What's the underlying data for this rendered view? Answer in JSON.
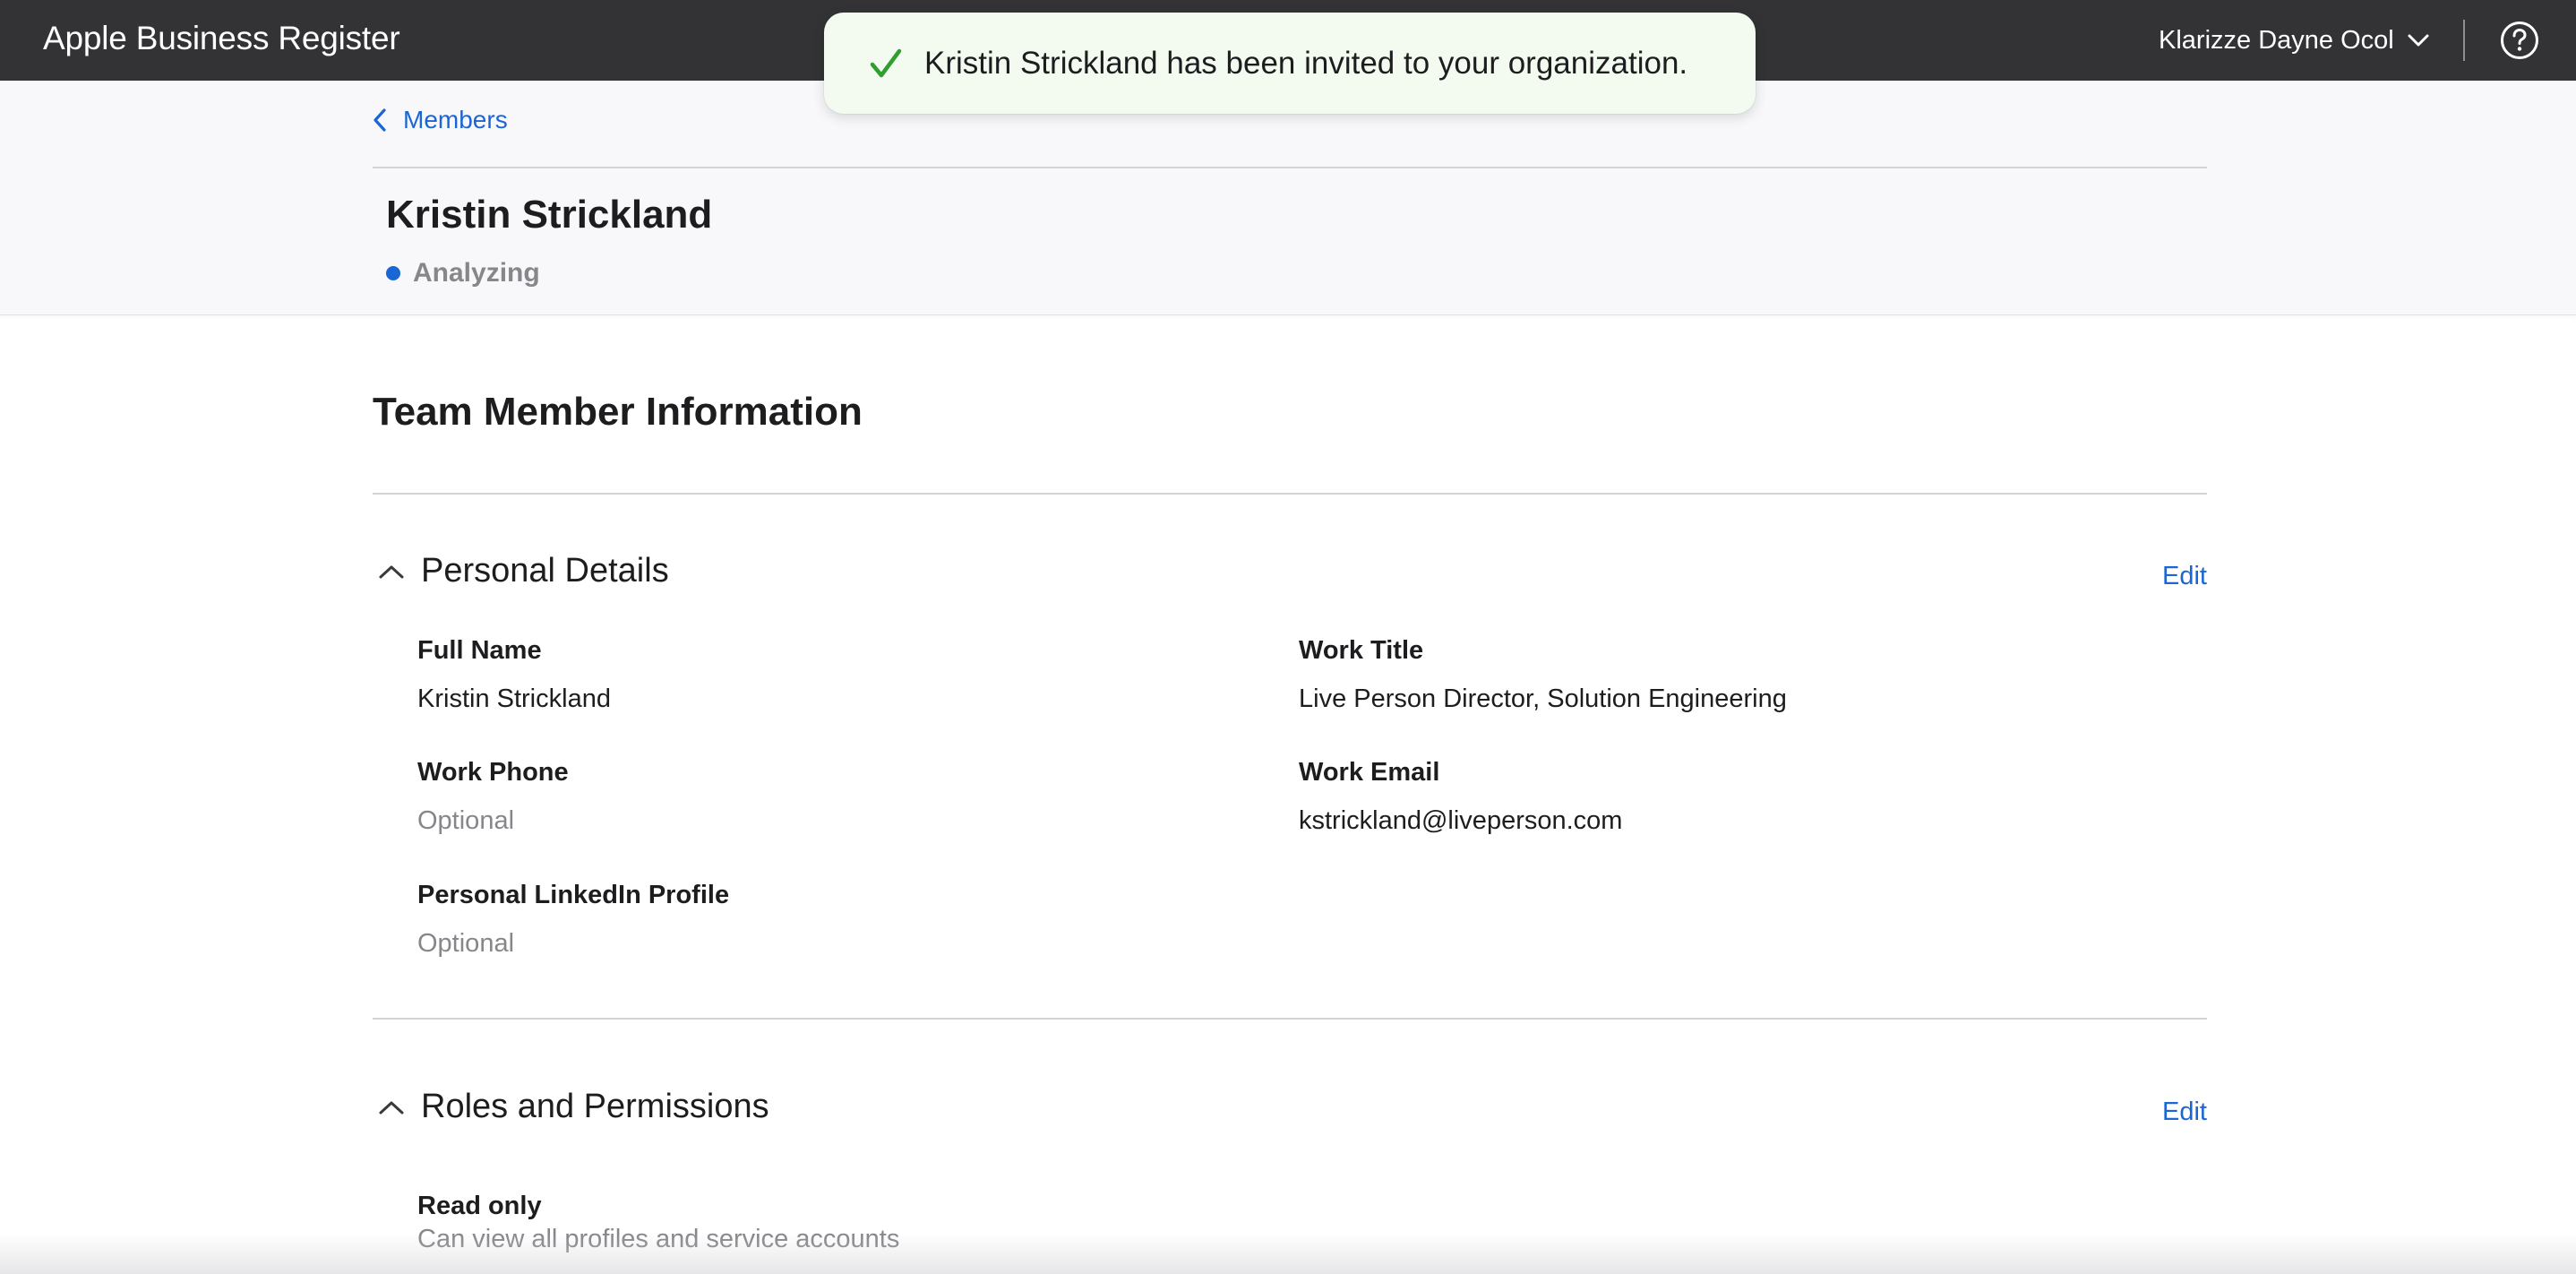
{
  "topbar": {
    "brand": "Apple Business Register",
    "user_name": "Klarizze Dayne Ocol"
  },
  "toast": {
    "message": "Kristin Strickland has been invited to your organization."
  },
  "header": {
    "back_label": "Members",
    "member_name": "Kristin Strickland",
    "status": "Analyzing"
  },
  "main": {
    "section_title": "Team Member Information",
    "personal_details": {
      "title": "Personal Details",
      "edit_label": "Edit",
      "fields": {
        "full_name": {
          "label": "Full Name",
          "value": "Kristin Strickland"
        },
        "work_title": {
          "label": "Work Title",
          "value": "Live Person Director, Solution Engineering"
        },
        "work_phone": {
          "label": "Work Phone",
          "value": "Optional"
        },
        "work_email": {
          "label": "Work Email",
          "value": "kstrickland@liveperson.com"
        },
        "linkedin": {
          "label": "Personal LinkedIn Profile",
          "value": "Optional"
        }
      }
    },
    "roles": {
      "title": "Roles and Permissions",
      "edit_label": "Edit",
      "role_name": "Read only",
      "role_description": "Can view all profiles and service accounts"
    }
  },
  "colors": {
    "topbar": "#333336",
    "accent": "#1a66d6",
    "success": "#2f9e2f",
    "toast_bg": "#f3fbf1"
  },
  "icons": [
    "chevron-down-icon",
    "help-icon",
    "checkmark-icon",
    "chevron-left-icon",
    "chevron-up-icon"
  ]
}
